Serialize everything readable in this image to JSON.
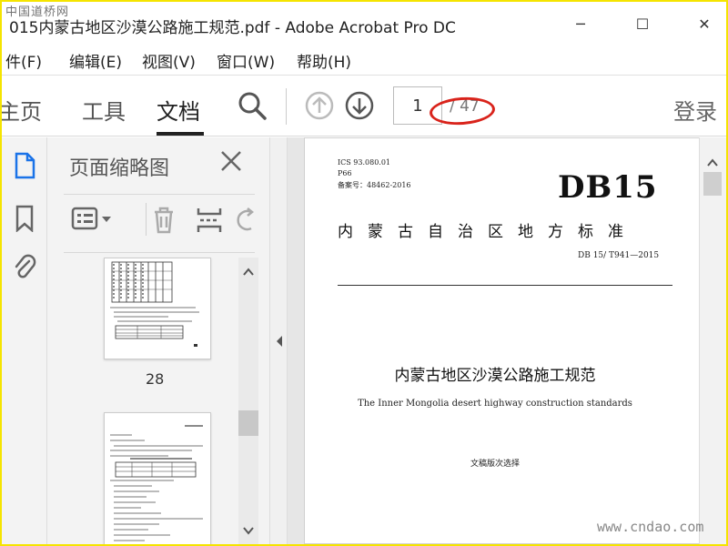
{
  "window": {
    "title": "015内蒙古地区沙漠公路施工规范.pdf - Adobe Acrobat Pro DC",
    "minimize": "─",
    "maximize": "☐",
    "close": "✕"
  },
  "watermark": {
    "top": "中国道桥网",
    "bottom": "www.cndao.com"
  },
  "menu": {
    "items": [
      "件(F)",
      "编辑(E)",
      "视图(V)",
      "窗口(W)",
      "帮助(H)"
    ]
  },
  "toolbar": {
    "tabs": [
      "主页",
      "工具",
      "文档"
    ],
    "active_tab": "文档",
    "page_current": "1",
    "page_total": "/ 47",
    "login": "登录"
  },
  "thumbnails": {
    "title": "页面缩略图",
    "page_label": "28"
  },
  "document": {
    "ics": "ICS 93.080.01",
    "p_code": "P66",
    "record": "备案号：48462-2016",
    "db_code": "DB15",
    "region": "内蒙古自治区地方标准",
    "standard_no": "DB 15/ T941—2015",
    "title_cn": "内蒙古地区沙漠公路施工规范",
    "title_en": "The Inner Mongolia desert highway construction standards",
    "edition": "文稿版次选择"
  },
  "colors": {
    "frame_border": "#f5e400",
    "highlight_ellipse": "#d9231b",
    "active_icon": "#1a73e8"
  }
}
